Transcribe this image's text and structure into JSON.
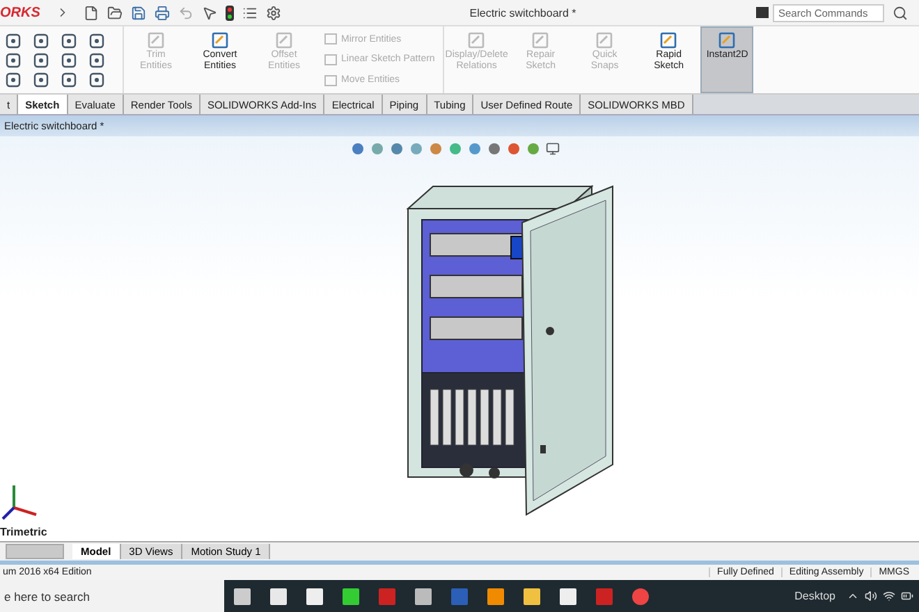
{
  "app": {
    "logo": "ORKS",
    "document_title": "Electric switchboard *",
    "search": {
      "placeholder": "Search Commands"
    }
  },
  "ribbon": {
    "items": [
      {
        "kind": "large",
        "label": "Trim Entities",
        "disabled": true,
        "selected": false
      },
      {
        "kind": "large",
        "label": "Convert Entities",
        "disabled": false,
        "selected": false
      },
      {
        "kind": "large",
        "label": "Offset Entities",
        "disabled": true,
        "selected": false
      },
      {
        "kind": "stack",
        "entries": [
          {
            "label": "Mirror Entities",
            "disabled": true
          },
          {
            "label": "Linear Sketch Pattern",
            "disabled": true
          },
          {
            "label": "Move Entities",
            "disabled": true
          }
        ]
      },
      {
        "kind": "large",
        "label": "Display/Delete Relations",
        "disabled": true,
        "selected": false
      },
      {
        "kind": "large",
        "label": "Repair Sketch",
        "disabled": true,
        "selected": false
      },
      {
        "kind": "large",
        "label": "Quick Snaps",
        "disabled": true,
        "selected": false
      },
      {
        "kind": "large",
        "label": "Rapid Sketch",
        "disabled": false,
        "selected": false
      },
      {
        "kind": "large",
        "label": "Instant2D",
        "disabled": false,
        "selected": true
      }
    ]
  },
  "tabs": [
    {
      "label": "t",
      "selected": false
    },
    {
      "label": "Sketch",
      "selected": true
    },
    {
      "label": "Evaluate",
      "selected": false
    },
    {
      "label": "Render Tools",
      "selected": false
    },
    {
      "label": "SOLIDWORKS Add-Ins",
      "selected": false
    },
    {
      "label": "Electrical",
      "selected": false
    },
    {
      "label": "Piping",
      "selected": false
    },
    {
      "label": "Tubing",
      "selected": false
    },
    {
      "label": "User Defined Route",
      "selected": false
    },
    {
      "label": "SOLIDWORKS MBD",
      "selected": false
    }
  ],
  "document": {
    "title": "Electric switchboard *",
    "view_label": "Trimetric"
  },
  "bottom_tabs": [
    {
      "label": "Model",
      "selected": true
    },
    {
      "label": "3D Views",
      "selected": false
    },
    {
      "label": "Motion Study 1",
      "selected": false
    }
  ],
  "status_bar": {
    "edition": "um 2016 x64 Edition",
    "cells": [
      "Fully Defined",
      "Editing Assembly",
      "MMGS"
    ]
  },
  "taskbar": {
    "search": {
      "placeholder": "e here to search"
    },
    "desktop_label": "Desktop"
  }
}
